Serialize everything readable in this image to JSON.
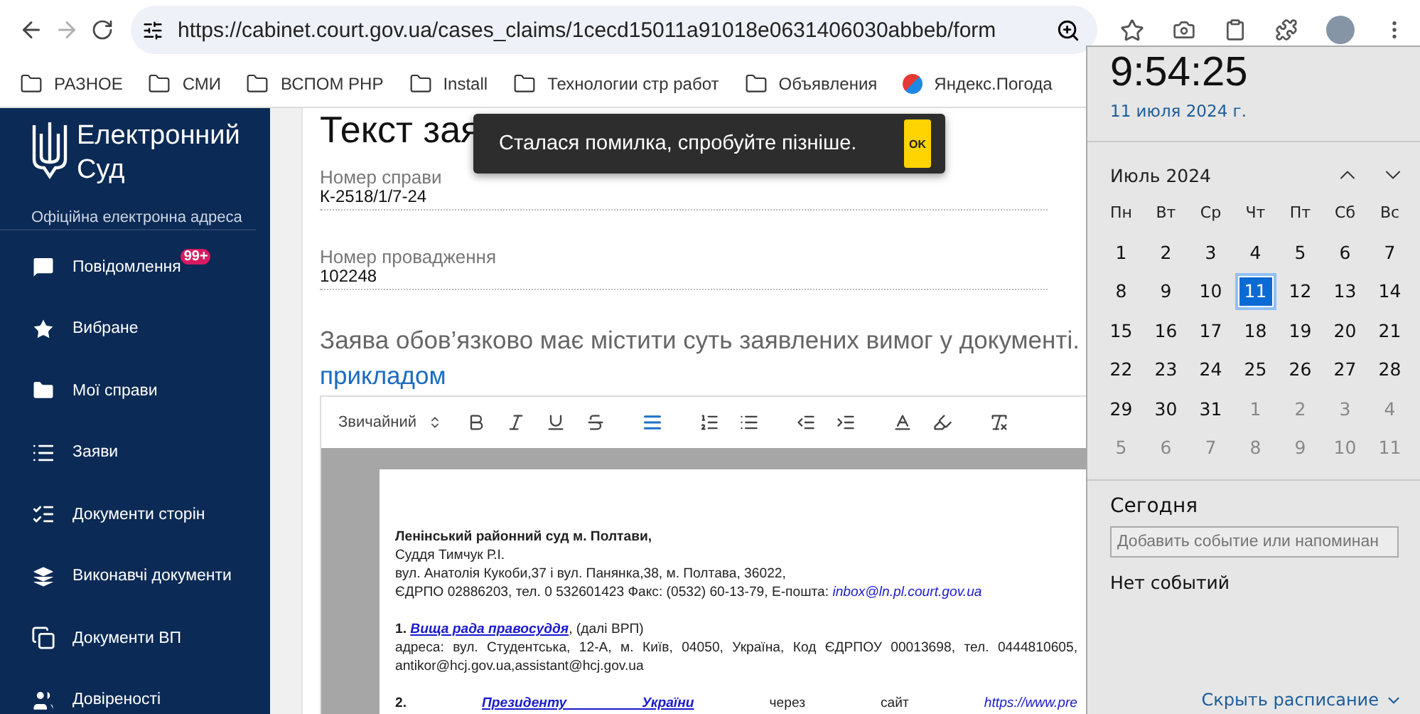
{
  "browser": {
    "url": "https://cabinet.court.gov.ua/cases_claims/1cecd15011a91018e0631406030abbeb/form"
  },
  "bookmarks": [
    {
      "kind": "folder",
      "label": "РАЗНОЕ"
    },
    {
      "kind": "folder",
      "label": "СМИ"
    },
    {
      "kind": "folder",
      "label": "ВСПОМ PHP"
    },
    {
      "kind": "folder",
      "label": "Install"
    },
    {
      "kind": "folder",
      "label": "Технологии стр работ"
    },
    {
      "kind": "folder",
      "label": "Объявления"
    },
    {
      "kind": "site",
      "label": "Яндекс.Погода"
    }
  ],
  "sidebar": {
    "logo_title": "Електронний Суд",
    "subtitle": "Офіційна електронна адреса",
    "items": [
      {
        "kind": "message",
        "label": "Повідомлення",
        "badge": "99+"
      },
      {
        "kind": "star",
        "label": "Вибране"
      },
      {
        "kind": "folder",
        "label": "Мої справи"
      },
      {
        "kind": "list",
        "label": "Заяви"
      },
      {
        "kind": "checklist",
        "label": "Документи сторін"
      },
      {
        "kind": "layers",
        "label": "Виконавчі документи"
      },
      {
        "kind": "copy",
        "label": "Документи ВП"
      },
      {
        "kind": "users",
        "label": "Довіреності"
      }
    ]
  },
  "form": {
    "title": "Текст зая",
    "fields": [
      {
        "label": "Номер справи",
        "value": "К-2518/1/7-24"
      },
      {
        "label": "Номер провадження",
        "value": "102248"
      }
    ],
    "instruction": "Заява обов’язково має містити суть заявлених вимог у документі.",
    "example_link": "прикладом",
    "editor": {
      "style_select": "Звичайний",
      "tools": [
        {
          "kind": "bold",
          "active": false
        },
        {
          "kind": "italic",
          "active": false
        },
        {
          "kind": "underline",
          "active": false
        },
        {
          "kind": "strike",
          "active": false
        },
        {
          "kind": "align",
          "active": true
        },
        {
          "kind": "ordered",
          "active": false
        },
        {
          "kind": "bullet",
          "active": false
        },
        {
          "kind": "outdent",
          "active": false
        },
        {
          "kind": "indent",
          "active": false
        },
        {
          "kind": "color",
          "active": false
        },
        {
          "kind": "background",
          "active": false
        },
        {
          "kind": "clean",
          "active": false
        }
      ],
      "lines": [
        {
          "kind": "blank"
        },
        {
          "kind": "para",
          "justify": false,
          "segments": [
            {
              "text": "Ленінський районний суд м. Полтави,",
              "bold": true,
              "link": false
            }
          ]
        },
        {
          "kind": "para",
          "justify": false,
          "segments": [
            {
              "text": "Суддя Тимчук Р.І.",
              "bold": false,
              "link": false
            }
          ]
        },
        {
          "kind": "para",
          "justify": false,
          "segments": [
            {
              "text": "вул. Анатолія Кукоби,37 і вул. Панянка,38, м. Полтава, 36022,",
              "bold": false,
              "link": false
            }
          ]
        },
        {
          "kind": "para",
          "justify": false,
          "segments": [
            {
              "text": "ЄДРПО 02886203, тел. 0 532601423 Факс: (0532) 60-13-79, Е-пошта: ",
              "bold": false,
              "link": false
            },
            {
              "text": "inbox@ln.pl.court.gov.ua",
              "bold": false,
              "link": true
            }
          ]
        },
        {
          "kind": "blank"
        },
        {
          "kind": "para",
          "justify": false,
          "segments": [
            {
              "text": "1. ",
              "bold": true,
              "link": false
            },
            {
              "text": "Вища рада правосуддя",
              "bold": true,
              "link": true
            },
            {
              "text": ", (далі ВРП)",
              "bold": false,
              "link": false
            }
          ]
        },
        {
          "kind": "para",
          "justify": true,
          "segments": [
            {
              "text": "адреса: вул. Студентська, 12-А, м. Київ, 04050, Україна, Код ЄДРПОУ 00013698, тел. 0444810605,",
              "bold": false,
              "link": false
            }
          ]
        },
        {
          "kind": "para",
          "segments": [
            {
              "text": "antikor@hcj.gov.ua,assistant@hcj.gov.ua",
              "bold": false,
              "link": false
            }
          ]
        },
        {
          "kind": "blank"
        },
        {
          "kind": "para",
          "justify": true,
          "segments": [
            {
              "text": "2. ",
              "bold": true,
              "link": false
            },
            {
              "text": "Президенту України",
              "bold": true,
              "link": true
            },
            {
              "text": " через сайт ",
              "bold": false,
              "link": false
            },
            {
              "text": "https://www.pre",
              "bold": false,
              "link": true
            }
          ]
        }
      ]
    }
  },
  "toast": {
    "message": "Сталася помилка, спробуйте пізніше.",
    "button": "OK"
  },
  "calendar": {
    "time": "9:54:25",
    "date": "11 июля 2024 г.",
    "month": "Июль 2024",
    "weekdays": [
      "Пн",
      "Вт",
      "Ср",
      "Чт",
      "Пт",
      "Сб",
      "Вс"
    ],
    "days": [
      {
        "label": "1",
        "in_month": true,
        "selected": false
      },
      {
        "label": "2",
        "in_month": true,
        "selected": false
      },
      {
        "label": "3",
        "in_month": true,
        "selected": false
      },
      {
        "label": "4",
        "in_month": true,
        "selected": false
      },
      {
        "label": "5",
        "in_month": true,
        "selected": false
      },
      {
        "label": "6",
        "in_month": true,
        "selected": false
      },
      {
        "label": "7",
        "in_month": true,
        "selected": false
      },
      {
        "label": "8",
        "in_month": true,
        "selected": false
      },
      {
        "label": "9",
        "in_month": true,
        "selected": false
      },
      {
        "label": "10",
        "in_month": true,
        "selected": false
      },
      {
        "label": "11",
        "in_month": true,
        "selected": true
      },
      {
        "label": "12",
        "in_month": true,
        "selected": false
      },
      {
        "label": "13",
        "in_month": true,
        "selected": false
      },
      {
        "label": "14",
        "in_month": true,
        "selected": false
      },
      {
        "label": "15",
        "in_month": true,
        "selected": false
      },
      {
        "label": "16",
        "in_month": true,
        "selected": false
      },
      {
        "label": "17",
        "in_month": true,
        "selected": false
      },
      {
        "label": "18",
        "in_month": true,
        "selected": false
      },
      {
        "label": "19",
        "in_month": true,
        "selected": false
      },
      {
        "label": "20",
        "in_month": true,
        "selected": false
      },
      {
        "label": "21",
        "in_month": true,
        "selected": false
      },
      {
        "label": "22",
        "in_month": true,
        "selected": false
      },
      {
        "label": "23",
        "in_month": true,
        "selected": false
      },
      {
        "label": "24",
        "in_month": true,
        "selected": false
      },
      {
        "label": "25",
        "in_month": true,
        "selected": false
      },
      {
        "label": "26",
        "in_month": true,
        "selected": false
      },
      {
        "label": "27",
        "in_month": true,
        "selected": false
      },
      {
        "label": "28",
        "in_month": true,
        "selected": false
      },
      {
        "label": "29",
        "in_month": true,
        "selected": false
      },
      {
        "label": "30",
        "in_month": true,
        "selected": false
      },
      {
        "label": "31",
        "in_month": true,
        "selected": false
      },
      {
        "label": "1",
        "in_month": false,
        "selected": false
      },
      {
        "label": "2",
        "in_month": false,
        "selected": false
      },
      {
        "label": "3",
        "in_month": false,
        "selected": false
      },
      {
        "label": "4",
        "in_month": false,
        "selected": false
      },
      {
        "label": "5",
        "in_month": false,
        "selected": false
      },
      {
        "label": "6",
        "in_month": false,
        "selected": false
      },
      {
        "label": "7",
        "in_month": false,
        "selected": false
      },
      {
        "label": "8",
        "in_month": false,
        "selected": false
      },
      {
        "label": "9",
        "in_month": false,
        "selected": false
      },
      {
        "label": "10",
        "in_month": false,
        "selected": false
      },
      {
        "label": "11",
        "in_month": false,
        "selected": false
      }
    ],
    "today_heading": "Сегодня",
    "event_placeholder": "Добавить событие или напоминан",
    "no_events": "Нет событий",
    "hide_link": "Скрыть расписание"
  }
}
